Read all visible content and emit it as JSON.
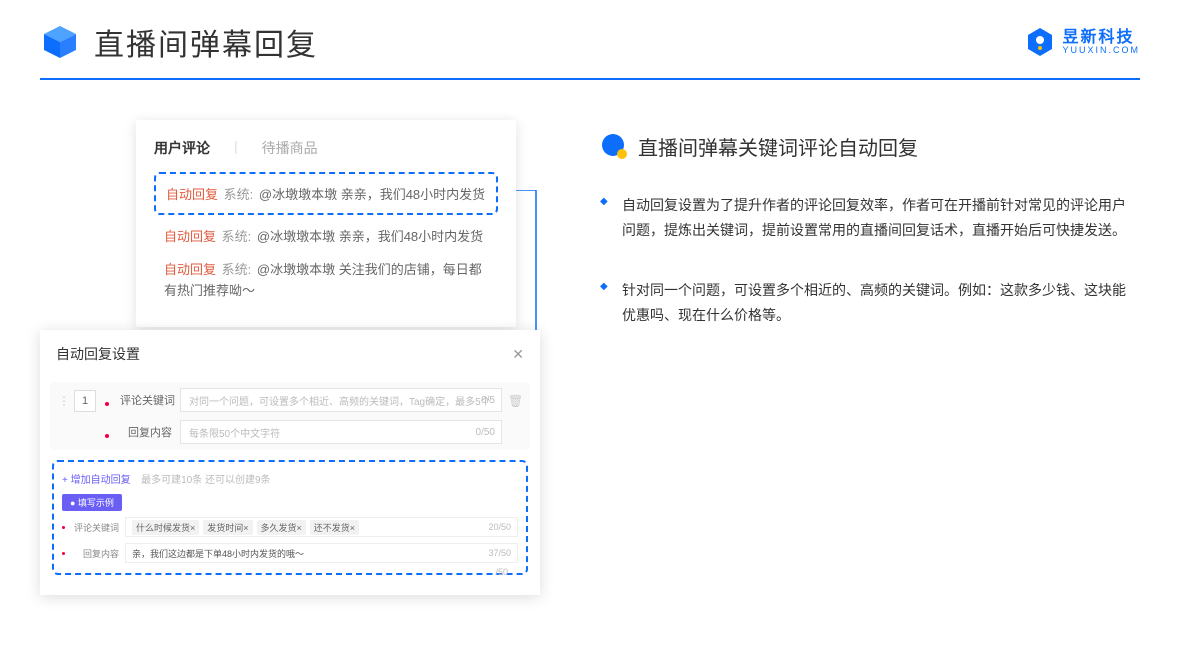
{
  "header": {
    "title": "直播间弹幕回复",
    "brand_cn": "昱新科技",
    "brand_en": "YUUXIN.COM"
  },
  "comments": {
    "tab_active": "用户评论",
    "tab_inactive": "待播商品",
    "auto_label": "自动回复",
    "sys_label": "系统:",
    "line1": "@冰墩墩本墩 亲亲，我们48小时内发货",
    "line2": "@冰墩墩本墩 亲亲，我们48小时内发货",
    "line3": "@冰墩墩本墩 关注我们的店铺，每日都有热门推荐呦～"
  },
  "settings": {
    "title": "自动回复设置",
    "idx": "1",
    "label_keyword": "评论关键词",
    "placeholder_keyword": "对同一个问题，可设置多个相近、高频的关键词，Tag确定，最多5个",
    "count_keyword": "0/5",
    "label_content": "回复内容",
    "placeholder_content": "每条限50个中文字符",
    "count_content": "0/50",
    "add_link": "+ 增加自动回复",
    "add_hint": "最多可建10条 还可以创建9条",
    "example_chip": "● 填写示例",
    "ex_label_keyword": "评论关键词",
    "ex_tags": [
      "什么时候发货×",
      "发货时间×",
      "多久发货×",
      "还不发货×"
    ],
    "ex_count_keyword": "20/50",
    "ex_label_content": "回复内容",
    "ex_content": "亲，我们这边都是下单48小时内发货的哦～",
    "ex_count_content": "37/50",
    "bottom_count": "/50"
  },
  "right": {
    "subtitle": "直播间弹幕关键词评论自动回复",
    "bullet1": "自动回复设置为了提升作者的评论回复效率，作者可在开播前针对常见的评论用户问题，提炼出关键词，提前设置常用的直播间回复话术，直播开始后可快捷发送。",
    "bullet2": "针对同一个问题，可设置多个相近的、高频的关键词。例如：这款多少钱、这块能优惠吗、现在什么价格等。"
  }
}
